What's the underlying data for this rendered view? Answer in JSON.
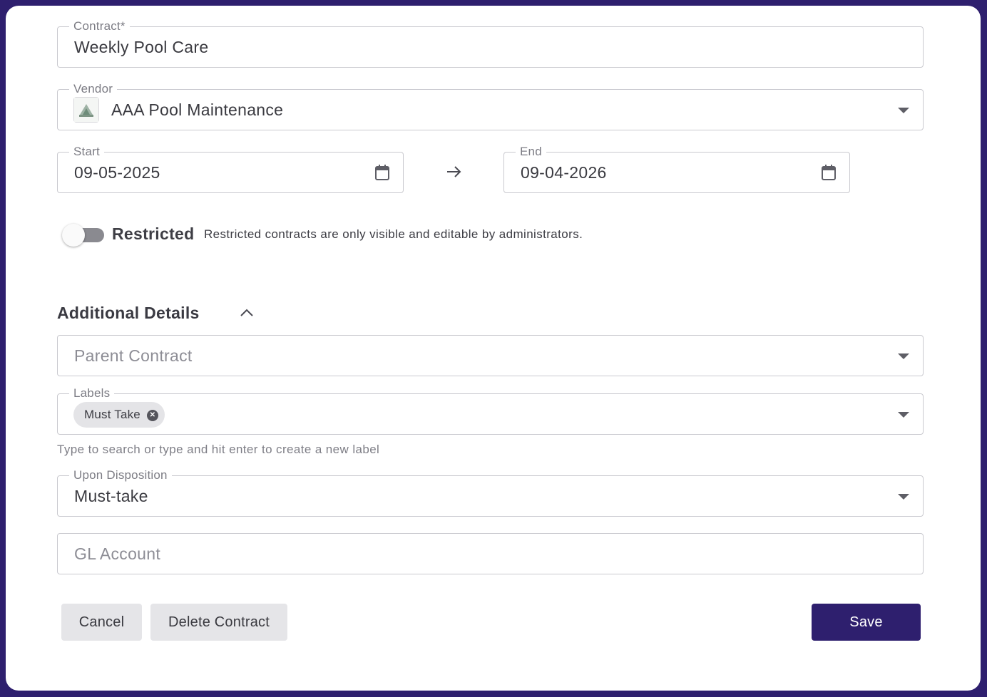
{
  "form": {
    "contract": {
      "label": "Contract*",
      "value": "Weekly Pool Care"
    },
    "vendor": {
      "label": "Vendor",
      "value": "AAA Pool Maintenance",
      "logo_icon": "vendor-logo"
    },
    "start": {
      "label": "Start",
      "value": "09-05-2025"
    },
    "end": {
      "label": "End",
      "value": "09-04-2026"
    },
    "restricted": {
      "label": "Restricted",
      "help": "Restricted contracts are only visible and editable by administrators.",
      "enabled": false
    }
  },
  "additional": {
    "title": "Additional Details",
    "expanded": true,
    "parent_contract": {
      "placeholder": "Parent Contract"
    },
    "labels": {
      "label": "Labels",
      "chips": [
        "Must Take"
      ],
      "helper": "Type to search or type and hit enter to create a new label"
    },
    "disposition": {
      "label": "Upon Disposition",
      "value": "Must-take"
    },
    "gl_account": {
      "placeholder": "GL Account"
    }
  },
  "actions": {
    "cancel": "Cancel",
    "delete": "Delete Contract",
    "save": "Save"
  },
  "colors": {
    "accent": "#2e1f6e",
    "border": "#c9c9cf",
    "toggle_off": "#8a8a90"
  }
}
